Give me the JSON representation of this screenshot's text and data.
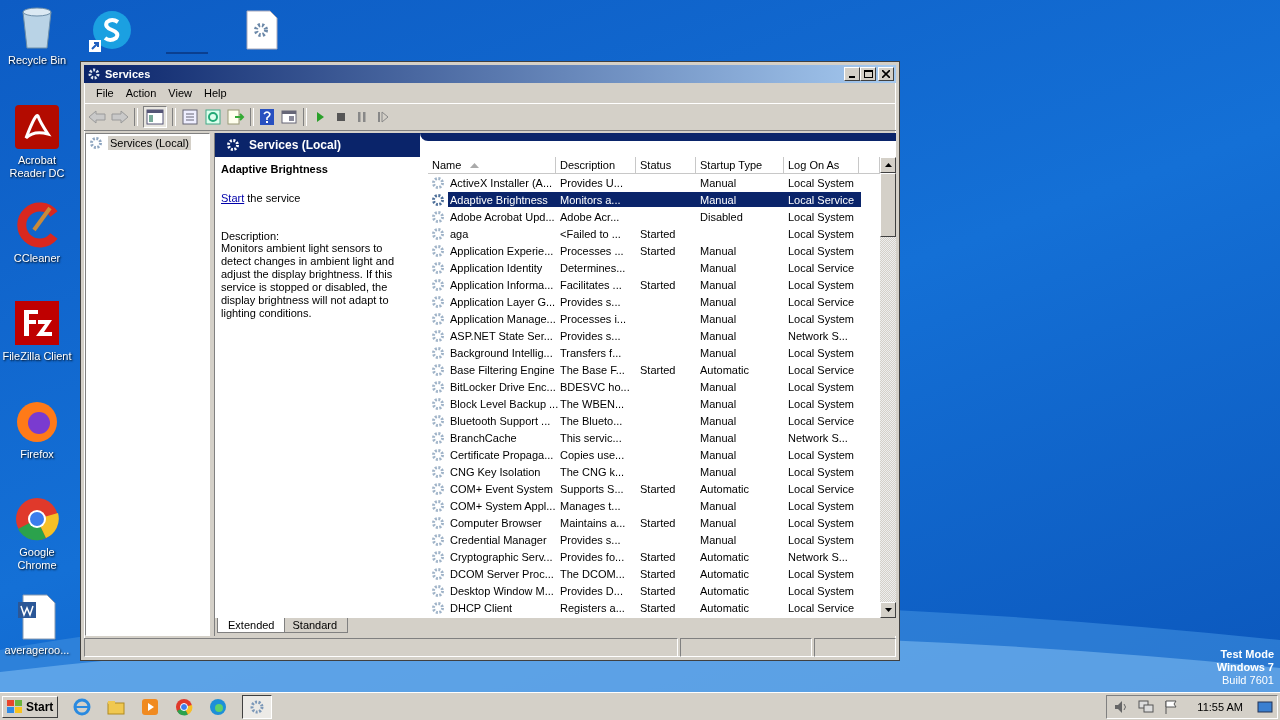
{
  "desktop_icons": [
    {
      "label": "Recycle Bin"
    },
    {
      "label": "Acrobat Reader DC"
    },
    {
      "label": "CCleaner"
    },
    {
      "label": "FileZilla Client"
    },
    {
      "label": "Firefox"
    },
    {
      "label": "Google Chrome"
    },
    {
      "label": "averageroo..."
    }
  ],
  "window": {
    "title": "Services"
  },
  "menu": [
    "File",
    "Action",
    "View",
    "Help"
  ],
  "tree": {
    "items": [
      {
        "label": "Services (Local)",
        "selected": true
      }
    ]
  },
  "pane_header": "Services (Local)",
  "details": {
    "title": "Adaptive Brightness",
    "action_link": "Start",
    "action_text": " the service",
    "description_label": "Description:",
    "description": "Monitors ambient light sensors to detect changes in ambient light and adjust the display brightness.  If this service is stopped or disabled, the display brightness will not adapt to lighting conditions."
  },
  "table": {
    "columns": [
      {
        "label": "Name",
        "sorted": true
      },
      {
        "label": "Description",
        "sorted": false
      },
      {
        "label": "Status",
        "sorted": false
      },
      {
        "label": "Startup Type",
        "sorted": false
      },
      {
        "label": "Log On As",
        "sorted": false
      }
    ],
    "rows": [
      {
        "name": "ActiveX Installer (A...",
        "description": "Provides U...",
        "status": "",
        "startup_type": "Manual",
        "log_on_as": "Local System",
        "selected": false
      },
      {
        "name": "Adaptive Brightness",
        "description": "Monitors a...",
        "status": "",
        "startup_type": "Manual",
        "log_on_as": "Local Service",
        "selected": true
      },
      {
        "name": "Adobe Acrobat Upd...",
        "description": "Adobe Acr...",
        "status": "",
        "startup_type": "Disabled",
        "log_on_as": "Local System",
        "selected": false
      },
      {
        "name": "aga",
        "description": "<Failed to ...",
        "status": "Started",
        "startup_type": "",
        "log_on_as": "Local System",
        "selected": false
      },
      {
        "name": "Application Experie...",
        "description": "Processes ...",
        "status": "Started",
        "startup_type": "Manual",
        "log_on_as": "Local System",
        "selected": false
      },
      {
        "name": "Application Identity",
        "description": "Determines...",
        "status": "",
        "startup_type": "Manual",
        "log_on_as": "Local Service",
        "selected": false
      },
      {
        "name": "Application Informa...",
        "description": "Facilitates ...",
        "status": "Started",
        "startup_type": "Manual",
        "log_on_as": "Local System",
        "selected": false
      },
      {
        "name": "Application Layer G...",
        "description": "Provides s...",
        "status": "",
        "startup_type": "Manual",
        "log_on_as": "Local Service",
        "selected": false
      },
      {
        "name": "Application Manage...",
        "description": "Processes i...",
        "status": "",
        "startup_type": "Manual",
        "log_on_as": "Local System",
        "selected": false
      },
      {
        "name": "ASP.NET State Ser...",
        "description": "Provides s...",
        "status": "",
        "startup_type": "Manual",
        "log_on_as": "Network S...",
        "selected": false
      },
      {
        "name": "Background Intellig...",
        "description": "Transfers f...",
        "status": "",
        "startup_type": "Manual",
        "log_on_as": "Local System",
        "selected": false
      },
      {
        "name": "Base Filtering Engine",
        "description": "The Base F...",
        "status": "Started",
        "startup_type": "Automatic",
        "log_on_as": "Local Service",
        "selected": false
      },
      {
        "name": "BitLocker Drive Enc...",
        "description": "BDESVC ho...",
        "status": "",
        "startup_type": "Manual",
        "log_on_as": "Local System",
        "selected": false
      },
      {
        "name": "Block Level Backup ...",
        "description": "The WBEN...",
        "status": "",
        "startup_type": "Manual",
        "log_on_as": "Local System",
        "selected": false
      },
      {
        "name": "Bluetooth Support ...",
        "description": "The Blueto...",
        "status": "",
        "startup_type": "Manual",
        "log_on_as": "Local Service",
        "selected": false
      },
      {
        "name": "BranchCache",
        "description": "This servic...",
        "status": "",
        "startup_type": "Manual",
        "log_on_as": "Network S...",
        "selected": false
      },
      {
        "name": "Certificate Propaga...",
        "description": "Copies use...",
        "status": "",
        "startup_type": "Manual",
        "log_on_as": "Local System",
        "selected": false
      },
      {
        "name": "CNG Key Isolation",
        "description": "The CNG k...",
        "status": "",
        "startup_type": "Manual",
        "log_on_as": "Local System",
        "selected": false
      },
      {
        "name": "COM+ Event System",
        "description": "Supports S...",
        "status": "Started",
        "startup_type": "Automatic",
        "log_on_as": "Local Service",
        "selected": false
      },
      {
        "name": "COM+ System Appl...",
        "description": "Manages t...",
        "status": "",
        "startup_type": "Manual",
        "log_on_as": "Local System",
        "selected": false
      },
      {
        "name": "Computer Browser",
        "description": "Maintains a...",
        "status": "Started",
        "startup_type": "Manual",
        "log_on_as": "Local System",
        "selected": false
      },
      {
        "name": "Credential Manager",
        "description": "Provides s...",
        "status": "",
        "startup_type": "Manual",
        "log_on_as": "Local System",
        "selected": false
      },
      {
        "name": "Cryptographic Serv...",
        "description": "Provides fo...",
        "status": "Started",
        "startup_type": "Automatic",
        "log_on_as": "Network S...",
        "selected": false
      },
      {
        "name": "DCOM Server Proc...",
        "description": "The DCOM...",
        "status": "Started",
        "startup_type": "Automatic",
        "log_on_as": "Local System",
        "selected": false
      },
      {
        "name": "Desktop Window M...",
        "description": "Provides D...",
        "status": "Started",
        "startup_type": "Automatic",
        "log_on_as": "Local System",
        "selected": false
      },
      {
        "name": "DHCP Client",
        "description": "Registers a...",
        "status": "Started",
        "startup_type": "Automatic",
        "log_on_as": "Local Service",
        "selected": false
      }
    ]
  },
  "view_tabs": [
    {
      "label": "Extended",
      "selected": true
    },
    {
      "label": "Standard",
      "selected": false
    }
  ],
  "os_notice": [
    "Test Mode",
    "Windows 7",
    "Build 7601"
  ],
  "taskbar": {
    "start": "Start",
    "clock": "11:55 AM"
  }
}
